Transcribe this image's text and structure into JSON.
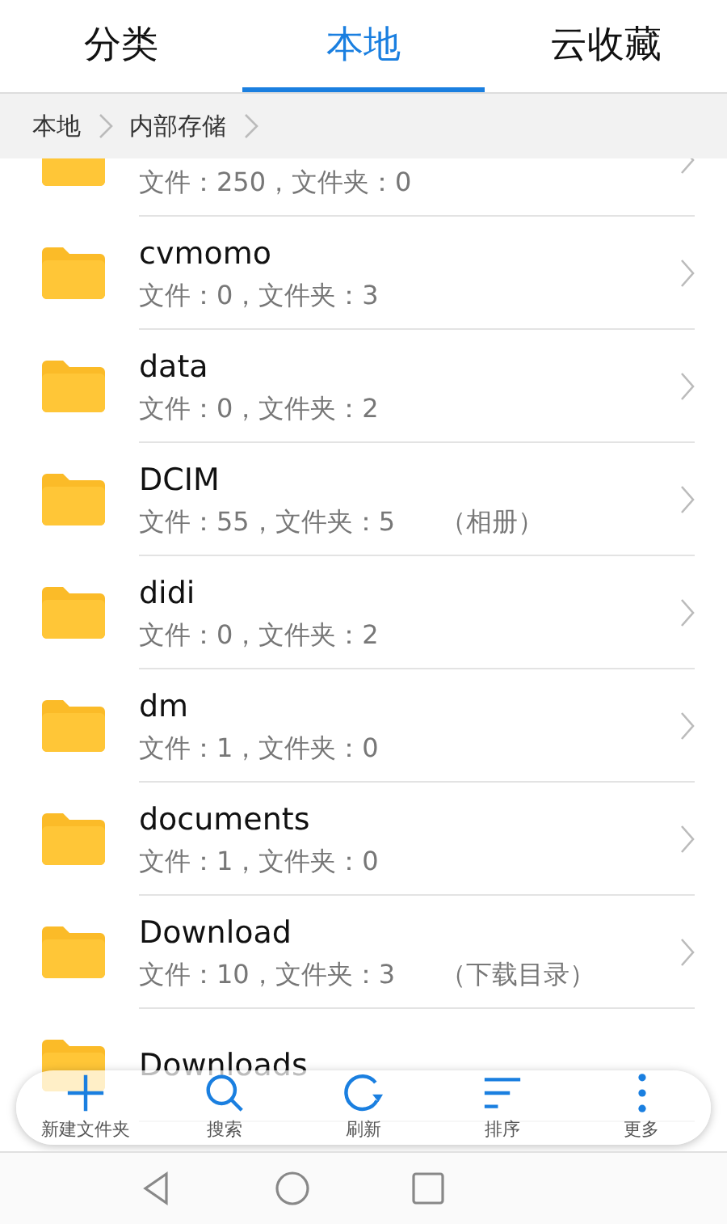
{
  "tabs": [
    {
      "label": "分类",
      "selected": false
    },
    {
      "label": "本地",
      "selected": true
    },
    {
      "label": "云收藏",
      "selected": false
    }
  ],
  "breadcrumb": [
    "本地",
    "内部存储"
  ],
  "folders": [
    {
      "subtitle": "文件：250，文件夹：0"
    },
    {
      "name": "cvmomo",
      "subtitle": "文件：0，文件夹：3"
    },
    {
      "name": "data",
      "subtitle": "文件：0，文件夹：2"
    },
    {
      "name": "DCIM",
      "subtitle": "文件：55，文件夹：5",
      "note": "（相册）"
    },
    {
      "name": "didi",
      "subtitle": "文件：0，文件夹：2"
    },
    {
      "name": "dm",
      "subtitle": "文件：1，文件夹：0"
    },
    {
      "name": "documents",
      "subtitle": "文件：1，文件夹：0"
    },
    {
      "name": "Download",
      "subtitle": "文件：10，文件夹：3",
      "note": "（下载目录）"
    },
    {
      "name": "Downloads"
    }
  ],
  "toolbar": [
    {
      "kind": "add",
      "label": "新建文件夹"
    },
    {
      "kind": "search",
      "label": "搜索"
    },
    {
      "kind": "refresh",
      "label": "刷新"
    },
    {
      "kind": "sort",
      "label": "排序"
    },
    {
      "kind": "more",
      "label": "更多"
    }
  ]
}
